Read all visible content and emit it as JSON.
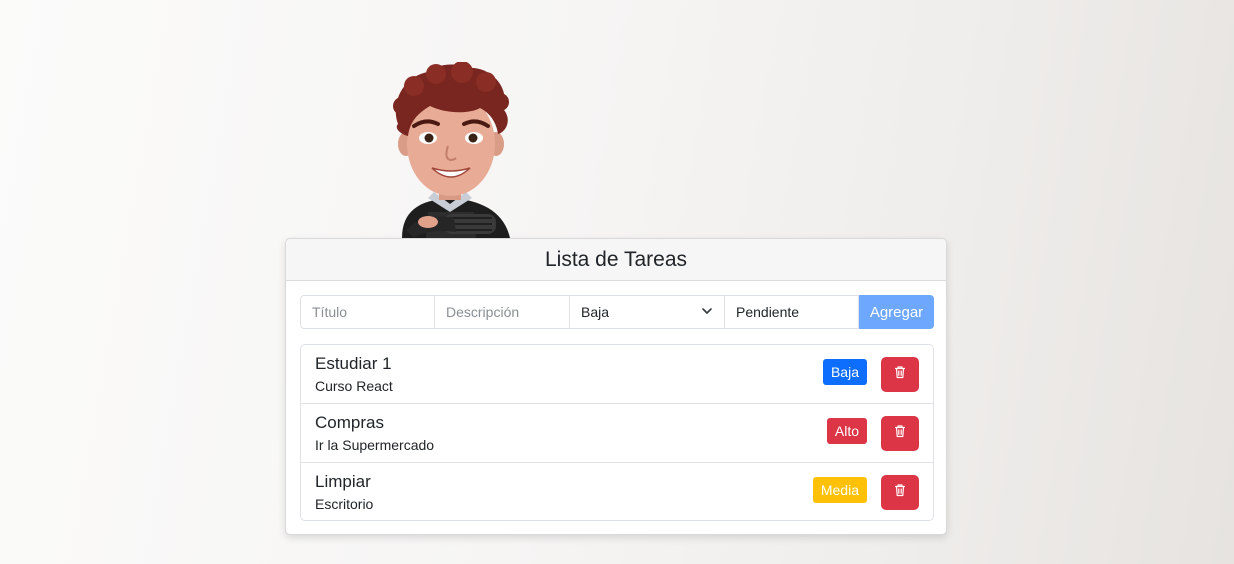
{
  "card": {
    "title": "Lista de Tareas"
  },
  "form": {
    "titulo_placeholder": "Título",
    "descripcion_placeholder": "Descripción",
    "prioridad_value": "Baja",
    "estado_value": "Pendiente",
    "add_label": "Agregar"
  },
  "tasks": [
    {
      "title": "Estudiar 1",
      "description": "Curso React",
      "priority": "Baja"
    },
    {
      "title": "Compras",
      "description": "Ir la Supermercado",
      "priority": "Alto"
    },
    {
      "title": "Limpiar",
      "description": "Escritorio",
      "priority": "Media"
    }
  ],
  "colors": {
    "primary": "#0d6efd",
    "primary_light": "#6ea8fe",
    "danger": "#dc3545",
    "warning": "#ffc107"
  },
  "icons": {
    "avatar": "memoji-avatar",
    "delete": "trash-icon",
    "select": "chevron-down-icon"
  }
}
